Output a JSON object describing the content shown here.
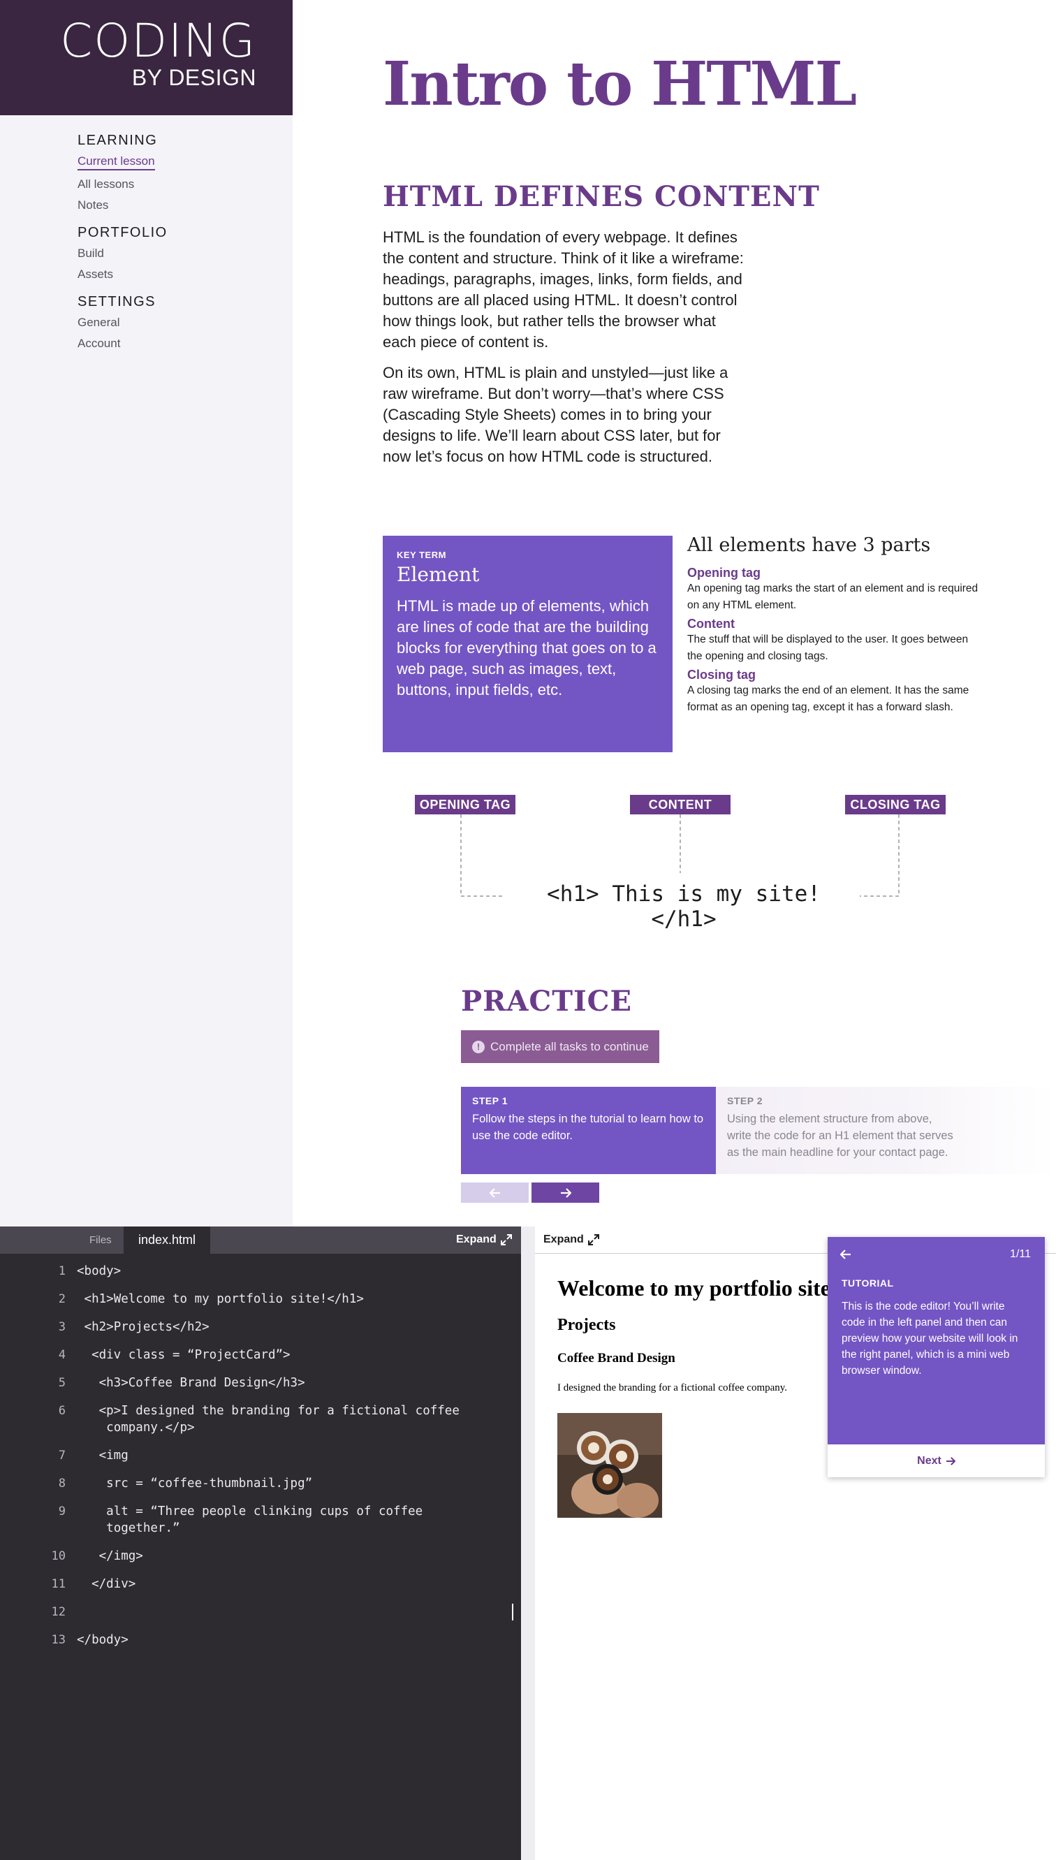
{
  "logo": {
    "line1": "CODING",
    "line2": "BY DESIGN"
  },
  "nav": {
    "sections": [
      {
        "title": "LEARNING",
        "items": [
          "Current lesson",
          "All lessons",
          "Notes"
        ]
      },
      {
        "title": "PORTFOLIO",
        "items": [
          "Build",
          "Assets"
        ]
      },
      {
        "title": "SETTINGS",
        "items": [
          "General",
          "Account"
        ]
      }
    ],
    "active_item": "Current lesson"
  },
  "lesson": {
    "title": "Intro to HTML",
    "section_title": "HTML DEFINES CONTENT",
    "paragraphs": [
      "HTML is the foundation of every webpage. It defines the content and structure. Think of it like a wireframe: headings, paragraphs, images, links, form fields, and buttons are all placed using HTML. It doesn’t control how things look, but rather tells the browser what each piece of content is.",
      "On its own, HTML is plain and unstyled—just like a raw wireframe. But don’t worry—that’s where CSS (Cascading Style Sheets) comes in to bring your designs to life. We’ll learn about CSS later, but for now let’s focus on how HTML code is structured."
    ],
    "key_term": {
      "label": "KEY TERM",
      "title": "Element",
      "body": "HTML is made up of elements, which are lines of code that are the building blocks for everything that goes on to a web page, such as images, text, buttons, input fields, etc."
    },
    "parts": {
      "heading": "All elements have 3 parts",
      "items": [
        {
          "title": "Opening tag",
          "desc": "An opening tag marks the start of an element and is required on any HTML element."
        },
        {
          "title": "Content",
          "desc": "The stuff that will be displayed to the user. It goes between the opening and closing tags."
        },
        {
          "title": "Closing tag",
          "desc": "A closing tag marks the end of an element. It has the same format as an opening tag, except it has a forward slash."
        }
      ]
    },
    "diagram": {
      "opening_label": "OPENING TAG",
      "content_label": "CONTENT",
      "closing_label": "CLOSING TAG",
      "code": "<h1> This is my site! </h1>"
    },
    "practice": {
      "title": "PRACTICE",
      "notice": "Complete all tasks to continue",
      "steps": [
        {
          "label": "STEP 1",
          "text": "Follow the steps in the tutorial to learn how to use the code editor."
        },
        {
          "label": "STEP 2",
          "text": "Using the element structure from above, write the code for an H1 element that serves as the main headline for your contact page."
        }
      ],
      "prev_icon": "arrow-left-icon",
      "next_icon": "arrow-right-icon"
    }
  },
  "editor": {
    "files_tab": "Files",
    "active_file": "index.html",
    "expand_label": "Expand",
    "lines": [
      {
        "n": "1",
        "text": "<body>"
      },
      {
        "n": "2",
        "text": " <h1>Welcome to my portfolio site!</h1>"
      },
      {
        "n": "3",
        "text": " <h2>Projects</h2>"
      },
      {
        "n": "4",
        "text": "  <div class = “ProjectCard”>"
      },
      {
        "n": "5",
        "text": "   <h3>Coffee Brand Design</h3>"
      },
      {
        "n": "6",
        "text": "   <p>I designed the branding for a fictional coffee\n    company.</p>"
      },
      {
        "n": "7",
        "text": "   <img"
      },
      {
        "n": "8",
        "text": "    src = “coffee-thumbnail.jpg”"
      },
      {
        "n": "9",
        "text": "    alt = “Three people clinking cups of coffee\n    together.”"
      },
      {
        "n": "10",
        "text": "   </img>"
      },
      {
        "n": "11",
        "text": "  </div>"
      },
      {
        "n": "12",
        "text": ""
      },
      {
        "n": "13",
        "text": "</body>"
      }
    ]
  },
  "preview": {
    "expand_label": "Expand",
    "h1": "Welcome to my portfolio site!",
    "h2": "Projects",
    "h3": "Coffee Brand Design",
    "p": "I designed the branding for a fictional coffee company."
  },
  "tutorial": {
    "count": "1/11",
    "label": "TUTORIAL",
    "text": "This is the code editor! You’ll write code in the left panel and then can preview how your website will look in the right panel, which is a mini web browser window.",
    "next_label": "Next"
  },
  "colors": {
    "brand_dark": "#3a2640",
    "accent_purple": "#6a3b8a",
    "violet_panel": "#7455c4",
    "editor_bg": "#2d2b30"
  }
}
